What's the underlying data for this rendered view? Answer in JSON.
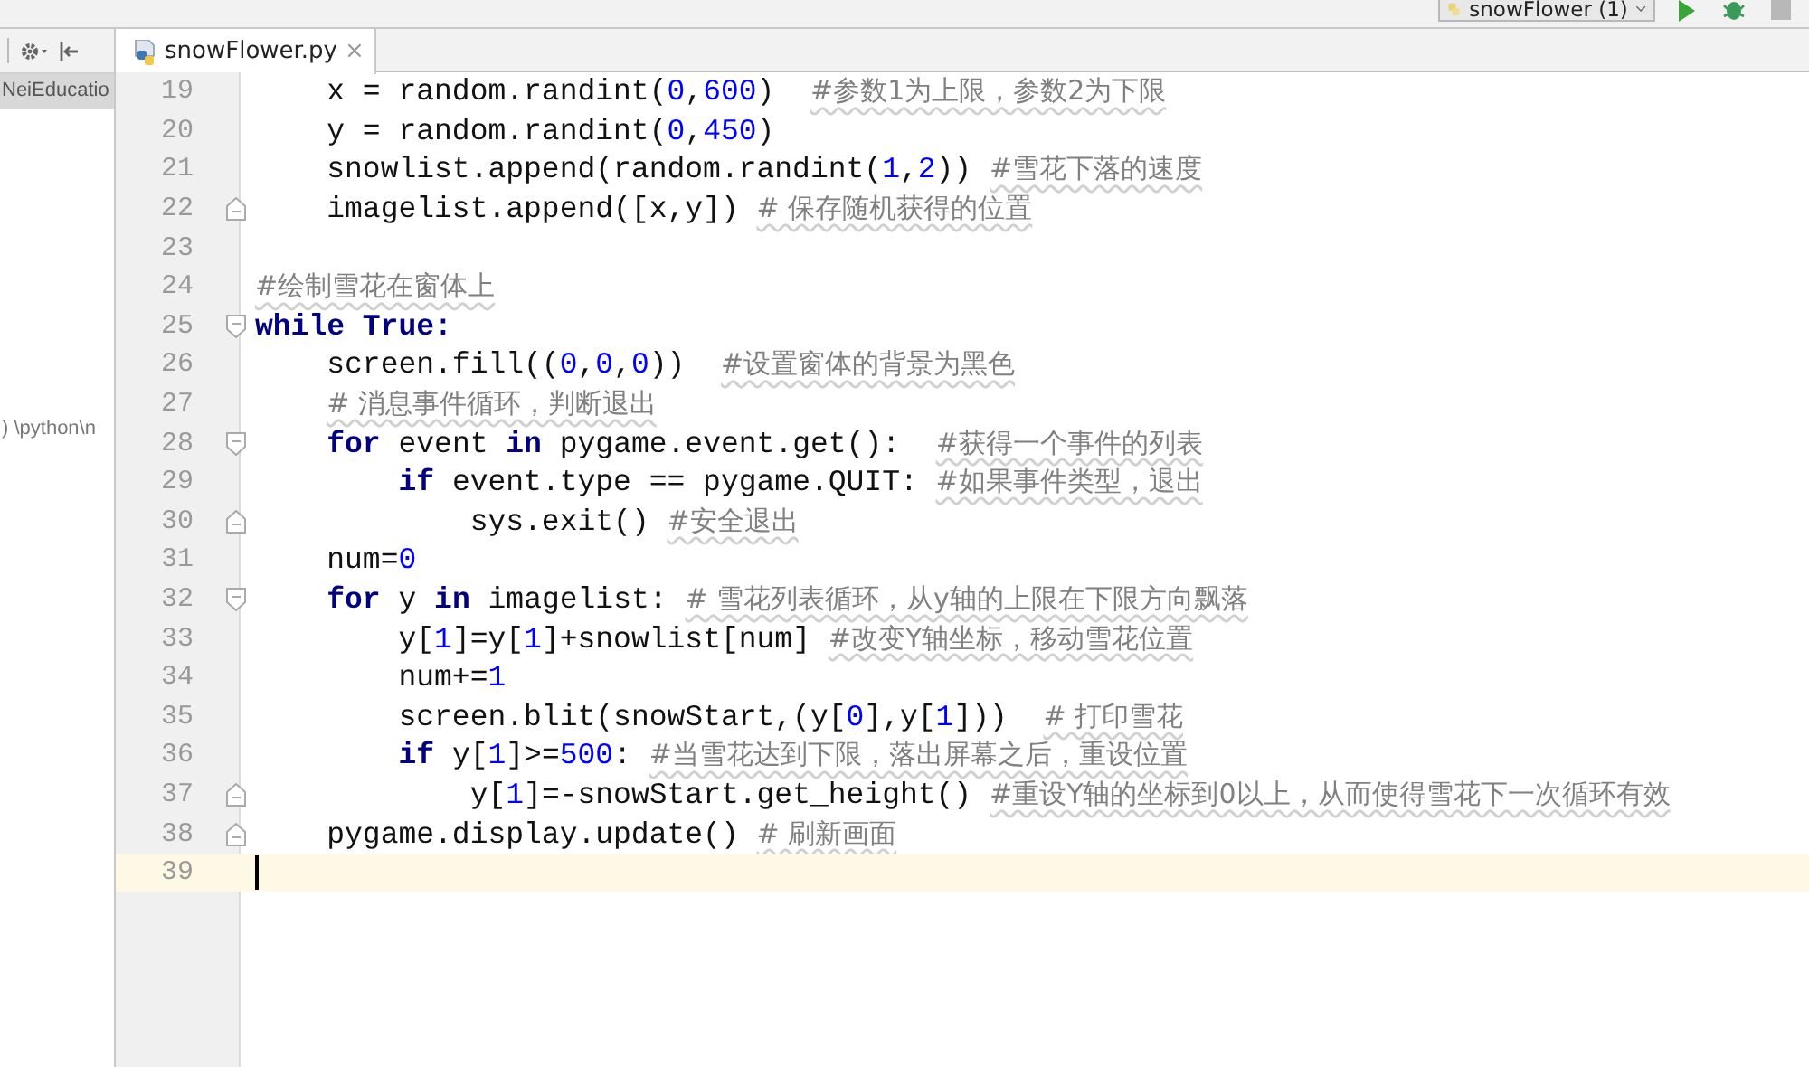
{
  "toolbar": {
    "run_config": "snowFlower (1)"
  },
  "project_panel": {
    "items": [
      {
        "label": "NeiEducatio",
        "selected": true
      },
      {
        "label": ") \\python\\n",
        "selected": false
      }
    ]
  },
  "tabs": [
    {
      "label": "snowFlower.py",
      "close": "×",
      "selected": true
    }
  ],
  "editor": {
    "lines": [
      {
        "number": "19",
        "fold_start": false,
        "fold_end": false,
        "current": false,
        "tokens": [
          {
            "kind": "plain",
            "text": "    x = random.randint("
          },
          {
            "kind": "number",
            "text": "0"
          },
          {
            "kind": "plain",
            "text": ","
          },
          {
            "kind": "number",
            "text": "600"
          },
          {
            "kind": "plain",
            "text": ")"
          },
          {
            "kind": "comment",
            "text": "  #参数1为上限，参数2为下限"
          }
        ]
      },
      {
        "number": "20",
        "fold_start": false,
        "fold_end": false,
        "current": false,
        "tokens": [
          {
            "kind": "plain",
            "text": "    y = random.randint("
          },
          {
            "kind": "number",
            "text": "0"
          },
          {
            "kind": "plain",
            "text": ","
          },
          {
            "kind": "number",
            "text": "450"
          },
          {
            "kind": "plain",
            "text": ")"
          }
        ]
      },
      {
        "number": "21",
        "fold_start": false,
        "fold_end": false,
        "current": false,
        "tokens": [
          {
            "kind": "plain",
            "text": "    snowlist.append(random.randint("
          },
          {
            "kind": "number",
            "text": "1"
          },
          {
            "kind": "plain",
            "text": ","
          },
          {
            "kind": "number",
            "text": "2"
          },
          {
            "kind": "plain",
            "text": "))"
          },
          {
            "kind": "comment",
            "text": " #雪花下落的速度"
          }
        ]
      },
      {
        "number": "22",
        "fold_start": false,
        "fold_end": true,
        "current": false,
        "tokens": [
          {
            "kind": "plain",
            "text": "    imagelist.append([x,y])"
          },
          {
            "kind": "comment",
            "text": " # 保存随机获得的位置"
          }
        ]
      },
      {
        "number": "23",
        "fold_start": false,
        "fold_end": false,
        "current": false
      },
      {
        "number": "24",
        "fold_start": false,
        "fold_end": false,
        "current": false,
        "tokens": [
          {
            "kind": "comment",
            "text": "#绘制雪花在窗体上"
          }
        ]
      },
      {
        "number": "25",
        "fold_start": true,
        "fold_end": false,
        "current": false,
        "tokens": [
          {
            "kind": "keyword",
            "text": "while True:"
          }
        ]
      },
      {
        "number": "26",
        "fold_start": false,
        "fold_end": false,
        "current": false,
        "tokens": [
          {
            "kind": "plain",
            "text": "    screen.fill(("
          },
          {
            "kind": "number",
            "text": "0"
          },
          {
            "kind": "plain",
            "text": ","
          },
          {
            "kind": "number",
            "text": "0"
          },
          {
            "kind": "plain",
            "text": ","
          },
          {
            "kind": "number",
            "text": "0"
          },
          {
            "kind": "plain",
            "text": "))"
          },
          {
            "kind": "comment",
            "text": "  #设置窗体的背景为黑色"
          }
        ]
      },
      {
        "number": "27",
        "fold_start": false,
        "fold_end": false,
        "current": false,
        "tokens": [
          {
            "kind": "comment",
            "text": "    # 消息事件循环，判断退出"
          }
        ]
      },
      {
        "number": "28",
        "fold_start": true,
        "fold_end": false,
        "current": false,
        "tokens": [
          {
            "kind": "keyword",
            "text": "    for"
          },
          {
            "kind": "plain",
            "text": " event "
          },
          {
            "kind": "keyword",
            "text": "in"
          },
          {
            "kind": "plain",
            "text": " pygame.event.get():"
          },
          {
            "kind": "comment",
            "text": "  #获得一个事件的列表"
          }
        ]
      },
      {
        "number": "29",
        "fold_start": false,
        "fold_end": false,
        "current": false,
        "tokens": [
          {
            "kind": "keyword",
            "text": "        if"
          },
          {
            "kind": "plain",
            "text": " event.type == pygame.QUIT:"
          },
          {
            "kind": "comment",
            "text": " #如果事件类型，退出"
          }
        ]
      },
      {
        "number": "30",
        "fold_start": false,
        "fold_end": true,
        "current": false,
        "tokens": [
          {
            "kind": "plain",
            "text": "            sys.exit()"
          },
          {
            "kind": "comment",
            "text": " #安全退出"
          }
        ]
      },
      {
        "number": "31",
        "fold_start": false,
        "fold_end": false,
        "current": false,
        "tokens": [
          {
            "kind": "plain",
            "text": "    num="
          },
          {
            "kind": "number",
            "text": "0"
          }
        ]
      },
      {
        "number": "32",
        "fold_start": true,
        "fold_end": false,
        "current": false,
        "tokens": [
          {
            "kind": "keyword",
            "text": "    for"
          },
          {
            "kind": "plain",
            "text": " y "
          },
          {
            "kind": "keyword",
            "text": "in"
          },
          {
            "kind": "plain",
            "text": " imagelist:"
          },
          {
            "kind": "comment",
            "text": " # 雪花列表循环，从y轴的上限在下限方向飘落"
          }
        ]
      },
      {
        "number": "33",
        "fold_start": false,
        "fold_end": false,
        "current": false,
        "tokens": [
          {
            "kind": "plain",
            "text": "        y["
          },
          {
            "kind": "number",
            "text": "1"
          },
          {
            "kind": "plain",
            "text": "]=y["
          },
          {
            "kind": "number",
            "text": "1"
          },
          {
            "kind": "plain",
            "text": "]+snowlist[num]"
          },
          {
            "kind": "comment",
            "text": " #改变Y轴坐标，移动雪花位置"
          }
        ]
      },
      {
        "number": "34",
        "fold_start": false,
        "fold_end": false,
        "current": false,
        "tokens": [
          {
            "kind": "plain",
            "text": "        num+="
          },
          {
            "kind": "number",
            "text": "1"
          }
        ]
      },
      {
        "number": "35",
        "fold_start": false,
        "fold_end": false,
        "current": false,
        "tokens": [
          {
            "kind": "plain",
            "text": "        screen.blit(snowStart,(y["
          },
          {
            "kind": "number",
            "text": "0"
          },
          {
            "kind": "plain",
            "text": "],y["
          },
          {
            "kind": "number",
            "text": "1"
          },
          {
            "kind": "plain",
            "text": "]))"
          },
          {
            "kind": "comment",
            "text": "  # 打印雪花"
          }
        ]
      },
      {
        "number": "36",
        "fold_start": false,
        "fold_end": false,
        "current": false,
        "tokens": [
          {
            "kind": "keyword",
            "text": "        if"
          },
          {
            "kind": "plain",
            "text": " y["
          },
          {
            "kind": "number",
            "text": "1"
          },
          {
            "kind": "plain",
            "text": "]>="
          },
          {
            "kind": "number",
            "text": "500"
          },
          {
            "kind": "plain",
            "text": ":"
          },
          {
            "kind": "comment",
            "text": " #当雪花达到下限，落出屏幕之后，重设位置"
          }
        ]
      },
      {
        "number": "37",
        "fold_start": false,
        "fold_end": true,
        "current": false,
        "tokens": [
          {
            "kind": "plain",
            "text": "            y["
          },
          {
            "kind": "number",
            "text": "1"
          },
          {
            "kind": "plain",
            "text": "]=-snowStart.get_height()"
          },
          {
            "kind": "comment",
            "text": " #重设Y轴的坐标到0以上，从而使得雪花下一次循环有效"
          }
        ]
      },
      {
        "number": "38",
        "fold_start": false,
        "fold_end": true,
        "current": false,
        "tokens": [
          {
            "kind": "plain",
            "text": "    pygame.display.update()"
          },
          {
            "kind": "comment",
            "text": " # 刷新画面"
          }
        ]
      },
      {
        "number": "39",
        "fold_start": false,
        "fold_end": false,
        "current": true
      }
    ]
  }
}
